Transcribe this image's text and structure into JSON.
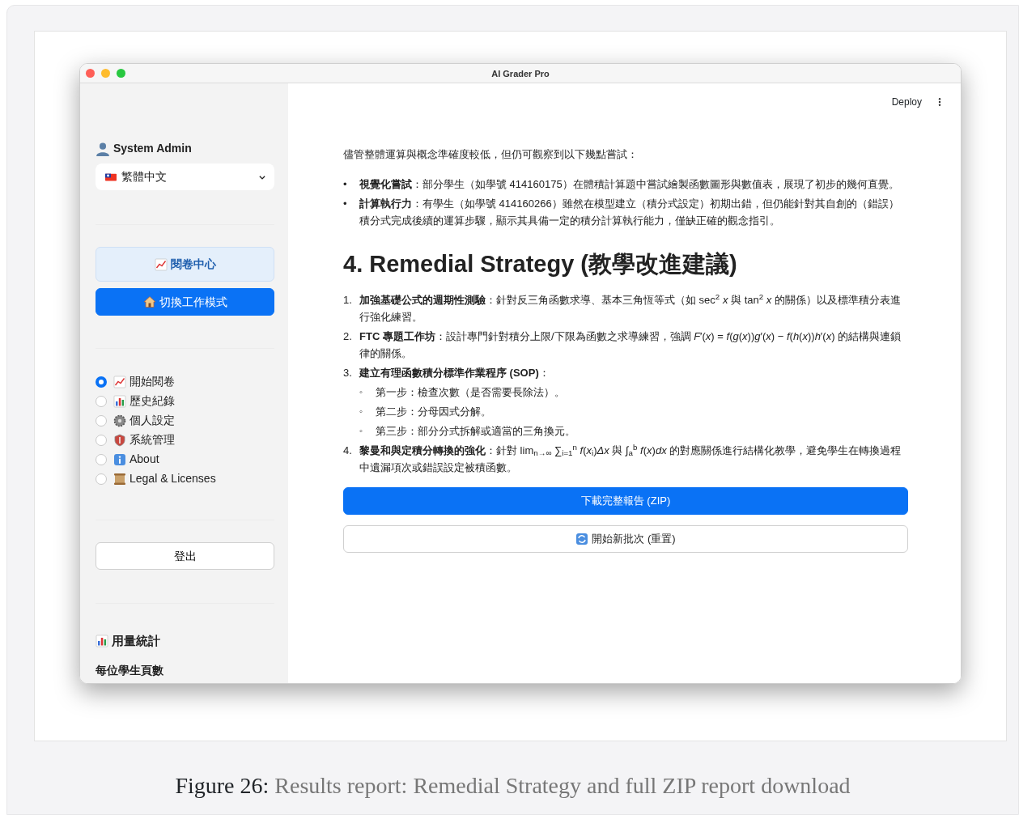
{
  "window": {
    "title": "AI Grader Pro"
  },
  "sidebar": {
    "user": "System Admin",
    "language": {
      "value": "繁體中文"
    },
    "nav_buttons": [
      {
        "label": "閱卷中心",
        "kind": "light"
      },
      {
        "label": "切換工作模式",
        "kind": "primary"
      }
    ],
    "pages": [
      {
        "label": "開始閱卷",
        "selected": true
      },
      {
        "label": "歷史紀錄",
        "selected": false
      },
      {
        "label": "個人設定",
        "selected": false
      },
      {
        "label": "系統管理",
        "selected": false
      },
      {
        "label": "About",
        "selected": false
      },
      {
        "label": "Legal & Licenses",
        "selected": false
      }
    ],
    "logout": "登出",
    "stats_heading": "用量統計",
    "stats_subheading": "每位學生頁數"
  },
  "header": {
    "deploy": "Deploy"
  },
  "content": {
    "intro": "儘管整體運算與概念準確度較低，但仍可觀察到以下幾點嘗試：",
    "bullets": [
      {
        "marker": "•",
        "text": "**視覺化嘗試**：部分學生（如學號 414160175）在體積計算題中嘗試繪製函數圖形與數值表，展現了初步的幾何直覺。"
      },
      {
        "marker": "•",
        "text": "**計算執行力**：有學生（如學號 414160266）雖然在模型建立（積分式設定）初期出錯，但仍能針對其自創的（錯誤）積分式完成後續的運算步驟，顯示其具備一定的積分計算執行能力，僅缺正確的觀念指引。"
      }
    ],
    "heading": "4. Remedial Strategy (教學改進建議)",
    "steps": [
      {
        "marker": "1.",
        "text": "**加強基礎公式的週期性測驗**：針對反三角函數求導、基本三角恆等式（如 sec$^{2}$ *x* 與 tan$^{2}$ *x* 的關係）以及標準積分表進行強化練習。"
      },
      {
        "marker": "2.",
        "text": "**FTC 專題工作坊**：設計專門針對積分上限/下限為函數之求導練習，強調 *F*′(*x*) = *f*(*g*(*x*))*g*′(*x*) − *f*(*h*(*x*))*h*′(*x*) 的結構與連鎖律的關係。"
      },
      {
        "marker": "3.",
        "text": "**建立有理函數積分標準作業程序 (SOP)**：",
        "children": [
          {
            "marker": "◦",
            "text": "第一步：檢查次數（是否需要長除法）。"
          },
          {
            "marker": "◦",
            "text": "第二步：分母因式分解。"
          },
          {
            "marker": "◦",
            "text": "第三步：部分分式拆解或適當的三角換元。"
          }
        ]
      },
      {
        "marker": "4.",
        "text": "**黎曼和與定積分轉換的強化**：針對 lim$_{n→∞}$ ∑$_{i=1}$$^{n}$ *f*(*x*$_{i}$)*Δx* 與 ∫$_{a}$$^{b}$ *f*(*x*)*dx* 的對應關係進行結構化教學，避免學生在轉換過程中遺漏項次或錯誤設定被積函數。"
      }
    ],
    "buttons": [
      {
        "label": "下載完整報告 (ZIP)",
        "kind": "primary"
      },
      {
        "label": "開始新批次 (重置)",
        "kind": "outline"
      }
    ]
  },
  "caption": {
    "label": "Figure 26:",
    "text": "Results report: Remedial Strategy and full ZIP report download"
  }
}
